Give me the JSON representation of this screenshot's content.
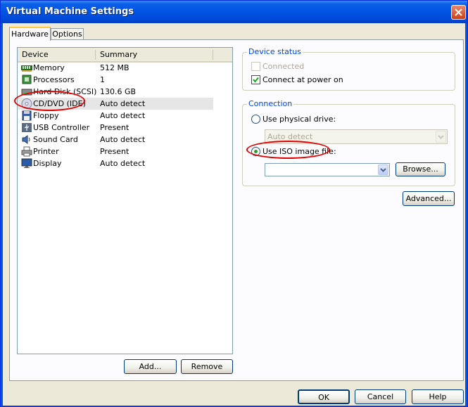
{
  "window": {
    "title": "Virtual Machine Settings"
  },
  "tabs": [
    {
      "label": "Hardware",
      "active": true
    },
    {
      "label": "Options",
      "active": false
    }
  ],
  "device_list": {
    "columns": [
      "Device",
      "Summary"
    ],
    "rows": [
      {
        "device": "Memory",
        "summary": "512 MB",
        "icon": "memory-icon"
      },
      {
        "device": "Processors",
        "summary": "1",
        "icon": "processor-icon"
      },
      {
        "device": "Hard Disk (SCSI)",
        "summary": "130.6 GB",
        "icon": "hard-disk-icon"
      },
      {
        "device": "CD/DVD (IDE)",
        "summary": "Auto detect",
        "icon": "cd-dvd-icon",
        "selected": true
      },
      {
        "device": "Floppy",
        "summary": "Auto detect",
        "icon": "floppy-icon"
      },
      {
        "device": "USB Controller",
        "summary": "Present",
        "icon": "usb-icon"
      },
      {
        "device": "Sound Card",
        "summary": "Auto detect",
        "icon": "sound-card-icon"
      },
      {
        "device": "Printer",
        "summary": "Present",
        "icon": "printer-icon"
      },
      {
        "device": "Display",
        "summary": "Auto detect",
        "icon": "display-icon"
      }
    ]
  },
  "list_buttons": {
    "add": "Add...",
    "remove": "Remove"
  },
  "device_status": {
    "title": "Device status",
    "connected": {
      "label": "Connected",
      "checked": false,
      "enabled": false
    },
    "connect_power": {
      "label": "Connect at power on",
      "checked": true,
      "enabled": true
    }
  },
  "connection": {
    "title": "Connection",
    "physical": {
      "label": "Use physical drive:",
      "selected": false
    },
    "physical_drive_value": "Auto detect",
    "iso": {
      "label": "Use ISO image file:",
      "selected": true
    },
    "iso_path_value": "",
    "browse_label": "Browse..."
  },
  "advanced_label": "Advanced...",
  "footer": {
    "ok": "OK",
    "cancel": "Cancel",
    "help": "Help"
  },
  "colors": {
    "titlebar": "#0054e3",
    "annotation": "#e00000",
    "group_label": "#0046d5"
  }
}
